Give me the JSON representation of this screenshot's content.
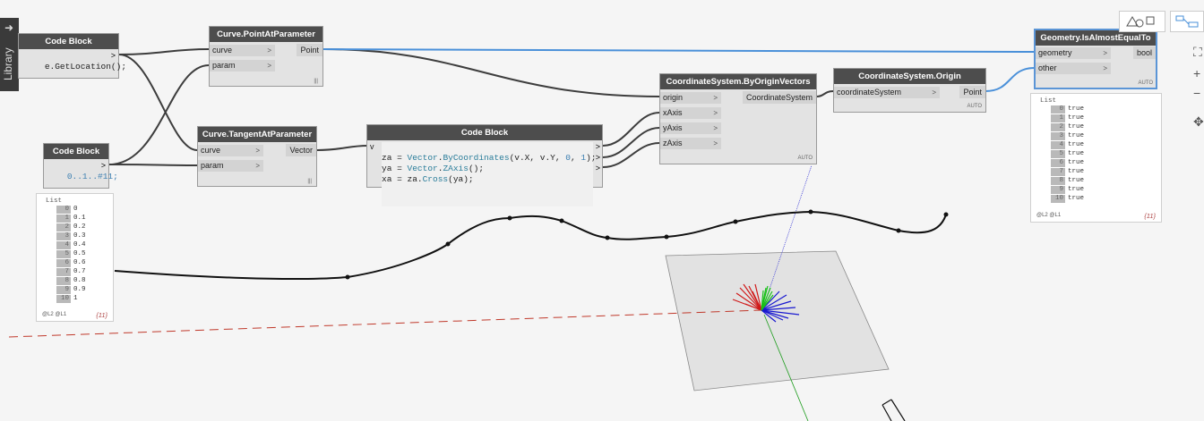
{
  "library": {
    "label": "Library"
  },
  "nodes": {
    "code_block_1": {
      "title": "Code Block",
      "code": "e.GetLocation();"
    },
    "point_at_param": {
      "title": "Curve.PointAtParameter",
      "inputs": [
        "curve",
        "param"
      ],
      "output": "Point",
      "lacing": "|||"
    },
    "tangent_at_param": {
      "title": "Curve.TangentAtParameter",
      "inputs": [
        "curve",
        "param"
      ],
      "output": "Vector",
      "lacing": "|||"
    },
    "code_block_2": {
      "title": "Code Block",
      "code": "0..1..#11;"
    },
    "code_block_3": {
      "title": "Code Block",
      "port_in": "v",
      "line1": [
        "za = ",
        "Vector",
        ".",
        "ByCoordinates",
        "(v.X, v.Y, ",
        "0",
        ", ",
        "1",
        ");"
      ],
      "line2": [
        "ya = ",
        "Vector",
        ".",
        "ZAxis",
        "();"
      ],
      "line3": [
        "xa = za.",
        "Cross",
        "(ya);"
      ]
    },
    "cs_by_origin_vectors": {
      "title": "CoordinateSystem.ByOriginVectors",
      "inputs": [
        "origin",
        "xAxis",
        "yAxis",
        "zAxis"
      ],
      "output": "CoordinateSystem",
      "lacing": "AUTO"
    },
    "cs_origin": {
      "title": "CoordinateSystem.Origin",
      "inputs": [
        "coordinateSystem"
      ],
      "output": "Point",
      "lacing": "AUTO"
    },
    "is_almost_equal": {
      "title": "Geometry.IsAlmostEqualTo",
      "inputs": [
        "geometry",
        "other"
      ],
      "output": "bool",
      "lacing": "AUTO"
    }
  },
  "watch_numbers": {
    "header": "List",
    "items": [
      {
        "i": "0",
        "v": "0"
      },
      {
        "i": "1",
        "v": "0.1"
      },
      {
        "i": "2",
        "v": "0.2"
      },
      {
        "i": "3",
        "v": "0.3"
      },
      {
        "i": "4",
        "v": "0.4"
      },
      {
        "i": "5",
        "v": "0.5"
      },
      {
        "i": "6",
        "v": "0.6"
      },
      {
        "i": "7",
        "v": "0.7"
      },
      {
        "i": "8",
        "v": "0.8"
      },
      {
        "i": "9",
        "v": "0.9"
      },
      {
        "i": "10",
        "v": "1"
      }
    ],
    "levels": "@L2 @L1",
    "count": "{11}"
  },
  "watch_bools": {
    "header": "List",
    "items": [
      {
        "i": "0",
        "v": "true"
      },
      {
        "i": "1",
        "v": "true"
      },
      {
        "i": "2",
        "v": "true"
      },
      {
        "i": "3",
        "v": "true"
      },
      {
        "i": "4",
        "v": "true"
      },
      {
        "i": "5",
        "v": "true"
      },
      {
        "i": "6",
        "v": "true"
      },
      {
        "i": "7",
        "v": "true"
      },
      {
        "i": "8",
        "v": "true"
      },
      {
        "i": "9",
        "v": "true"
      },
      {
        "i": "10",
        "v": "true"
      }
    ],
    "levels": "@L2 @L1",
    "count": "{11}"
  },
  "colors": {
    "wire": "#3d3d3d",
    "selected_wire": "#4a90d9",
    "node_header": "#4d4d4d",
    "axis_red": "#cc2222",
    "axis_green": "#22cc22",
    "axis_blue": "#2222cc"
  },
  "view_icons": [
    "geometry-view-icon",
    "graph-view-icon"
  ],
  "zoom_icons": [
    "fit-view-icon",
    "zoom-in-icon",
    "zoom-out-icon",
    "pan-icon"
  ]
}
